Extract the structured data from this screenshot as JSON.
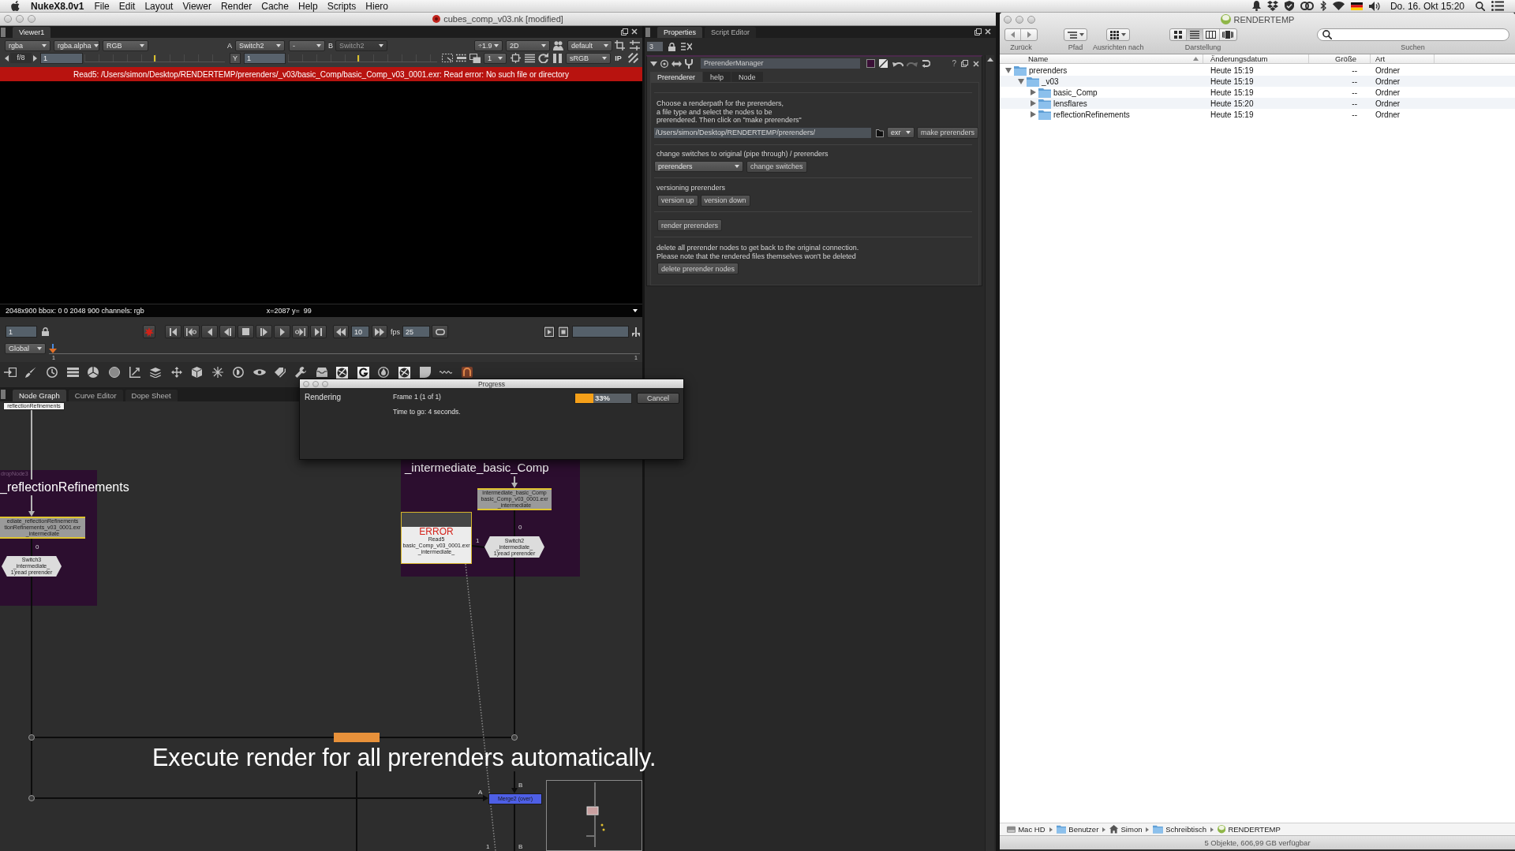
{
  "menu_bar": {
    "app_name": "NukeX8.0v1",
    "menus": [
      "File",
      "Edit",
      "Layout",
      "Viewer",
      "Render",
      "Cache",
      "Help",
      "Scripts",
      "Hiero"
    ],
    "clock": "Do. 16. Okt 15:20"
  },
  "nuke_window": {
    "title": "cubes_comp_v03.nk [modified]"
  },
  "viewer": {
    "tab": "Viewer1",
    "channels": [
      "rgba",
      "rgba.alpha",
      "RGB"
    ],
    "input_a": {
      "label": "A",
      "value": "Switch2"
    },
    "wipe": "-",
    "input_b": {
      "label": "B",
      "value": "Switch2",
      "disabled": true
    },
    "zoom": "÷1.9",
    "view_mode": "2D",
    "lut": "default",
    "f_stop": "f/8",
    "gain": {
      "value": "1",
      "level": 0.5
    },
    "gamma": {
      "label": "Y",
      "value": "1",
      "level": 0.47
    },
    "proxy": "1",
    "colorspace": "sRGB",
    "ip": "IP",
    "error": "Read5: /Users/simon/Desktop/RENDERTEMP/prerenders/_v03/basic_Comp/basic_Comp_v03_0001.exr: Read error: No such file or directory",
    "info": "2048x900 bbox: 0 0 2048 900 channels: rgb",
    "cursor": "x=2087 y=  99"
  },
  "timeline": {
    "frame": "1",
    "increment": "10",
    "fps_label": "fps",
    "fps": "25",
    "range": "Global",
    "level": 0,
    "start": "1",
    "end": "1"
  },
  "node_graph": {
    "tabs": [
      {
        "label": "Node Graph",
        "selected": true
      },
      {
        "label": "Curve Editor",
        "selected": false
      },
      {
        "label": "Dope Sheet",
        "selected": false
      }
    ],
    "backdrops": [
      {
        "label": "dropNode3",
        "title": "_reflectionRefinements"
      },
      {
        "title": "_intermediate_basic_Comp"
      }
    ],
    "nodes": [
      {
        "kind": "tag",
        "lines": [
          "reflectionRefinements"
        ]
      },
      {
        "kind": "read",
        "lines": [
          "ediate_reflectionRefinements",
          "tionRefinements_v03_0001.exr",
          "_intermediate"
        ]
      },
      {
        "kind": "switch",
        "lines": [
          "Switch3",
          "_intermediate_",
          "1)read prerender"
        ]
      },
      {
        "kind": "read",
        "lines": [
          "intermediate_basic_Comp",
          "basic_Comp_v03_0001.exr",
          "_intermediate"
        ]
      },
      {
        "kind": "read_error",
        "error": "ERROR",
        "lines": [
          "Read5",
          "basic_Comp_v03_0001.exr",
          "_intermediate_"
        ]
      },
      {
        "kind": "switch",
        "lines": [
          "Switch2",
          "_intermediate_",
          "1)read prerender"
        ]
      },
      {
        "kind": "write"
      },
      {
        "kind": "merge",
        "lines": [
          "Merge2 (over)"
        ]
      }
    ],
    "edge_labels": [
      "0",
      "0",
      "1",
      "A",
      "B",
      "1",
      "B"
    ]
  },
  "progress": {
    "title": "Progress",
    "task": "Rendering",
    "frame": "Frame 1 (1 of 1)",
    "remaining": "Time to go: 4 seconds.",
    "level": 0.33,
    "percent": "33%",
    "button": "Cancel"
  },
  "properties": {
    "tabs": [
      {
        "label": "Properties",
        "selected": true
      },
      {
        "label": "Script Editor",
        "selected": false
      }
    ],
    "max_panels": "3",
    "node_name": "PrerenderManager",
    "help": "?",
    "node_tabs": [
      {
        "label": "Prerenderer",
        "selected": true
      },
      {
        "label": "help",
        "selected": false
      },
      {
        "label": "Node",
        "selected": false
      }
    ],
    "sections": [
      {
        "kind": "path",
        "text": "Choose a renderpath for the prerenders,\na file type and select the nodes to be\nprerendered. Then click on \"make prerenders\"",
        "path": "/Users/simon/Desktop/RENDERTEMP/prerenders/",
        "file_type": "exr",
        "button": "make prerenders"
      },
      {
        "kind": "menu",
        "text": "change switches to original (pipe through) / prerenders",
        "value": "prerenders",
        "button": "change switches"
      },
      {
        "kind": "buttons",
        "text": "versioning prerenders",
        "buttons": [
          "version up",
          "version down"
        ]
      },
      {
        "kind": "buttons",
        "buttons": [
          "render prerenders"
        ]
      },
      {
        "kind": "buttons",
        "text": "delete all prerender nodes to get back to the original connection.\nPlease note that the rendered files themselves won't be deleted",
        "buttons": [
          "delete prerender nodes"
        ]
      }
    ]
  },
  "finder": {
    "title": "RENDERTEMP",
    "toolbar": {
      "back": "Zurück",
      "path": "Pfad",
      "arrange": "Ausrichten nach",
      "view": "Darstellung",
      "search": "Suchen"
    },
    "view_modes": [
      {
        "kind": "icons",
        "selected": false
      },
      {
        "kind": "list",
        "selected": true
      },
      {
        "kind": "columns",
        "selected": false
      },
      {
        "kind": "cover_flow",
        "selected": false
      }
    ],
    "columns": [
      {
        "label": "Name",
        "sorted": true
      },
      {
        "label": "Änderungsdatum",
        "sorted": false
      },
      {
        "label": "Größe",
        "sorted": false
      },
      {
        "label": "Art",
        "sorted": false
      }
    ],
    "tree": [
      {
        "name": "prerenders",
        "date": "Heute 15:19",
        "size": "--",
        "type": "Ordner",
        "expanded": true,
        "children": [
          {
            "name": "_v03",
            "date": "Heute 15:19",
            "size": "--",
            "type": "Ordner",
            "expanded": true,
            "children": [
              {
                "name": "basic_Comp",
                "date": "Heute 15:19",
                "size": "--",
                "type": "Ordner",
                "expanded": false
              },
              {
                "name": "lensflares",
                "date": "Heute 15:20",
                "size": "--",
                "type": "Ordner",
                "expanded": false
              },
              {
                "name": "reflectionRefinements",
                "date": "Heute 15:19",
                "size": "--",
                "type": "Ordner",
                "expanded": false
              }
            ]
          }
        ]
      }
    ],
    "path_bar": [
      {
        "kind": "drive",
        "label": "Mac HD"
      },
      {
        "kind": "folder",
        "label": "Benutzer"
      },
      {
        "kind": "home",
        "label": "Simon"
      },
      {
        "kind": "folder",
        "label": "Schreibtisch"
      },
      {
        "kind": "volume",
        "label": "RENDERTEMP"
      }
    ],
    "status": "5 Objekte, 606,99 GB verfügbar"
  },
  "caption": "Execute render for all prerenders automatically."
}
